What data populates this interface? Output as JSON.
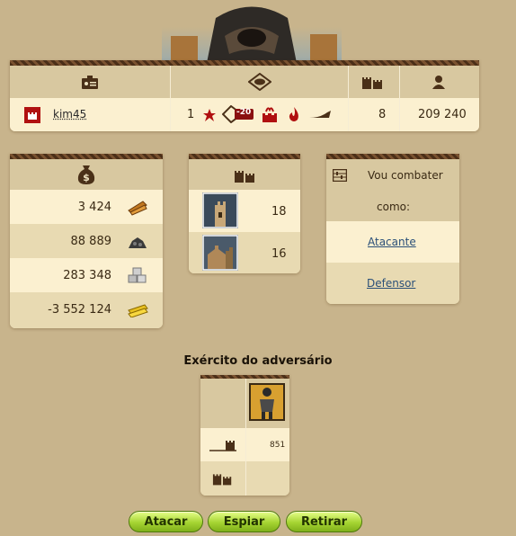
{
  "player": {
    "name": "kim45",
    "level": "1",
    "badge_minus": "-20",
    "villages": "8",
    "population": "209 240"
  },
  "resources": [
    {
      "value": "3 424",
      "icon": "wood-icon"
    },
    {
      "value": "88 889",
      "icon": "ore-icon"
    },
    {
      "value": "283 348",
      "icon": "stone-icon"
    },
    {
      "value": "-3 552 124",
      "icon": "gold-icon"
    }
  ],
  "castles": [
    {
      "value": "18"
    },
    {
      "value": "16"
    }
  ],
  "combat": {
    "prompt_line1": "Vou combater",
    "prompt_line2": "como:",
    "attacker_label": "Atacante",
    "defender_label": "Defensor"
  },
  "army": {
    "title": "Exército do adversário",
    "unit_count": "851"
  },
  "actions": {
    "attack": "Atacar",
    "spy": "Espiar",
    "retreat": "Retirar"
  },
  "colors": {
    "background": "#c8b48c",
    "panel": "#efe3c2",
    "header": "#d8c8a0",
    "accent_red": "#b01010",
    "button_green": "#a6d432"
  }
}
